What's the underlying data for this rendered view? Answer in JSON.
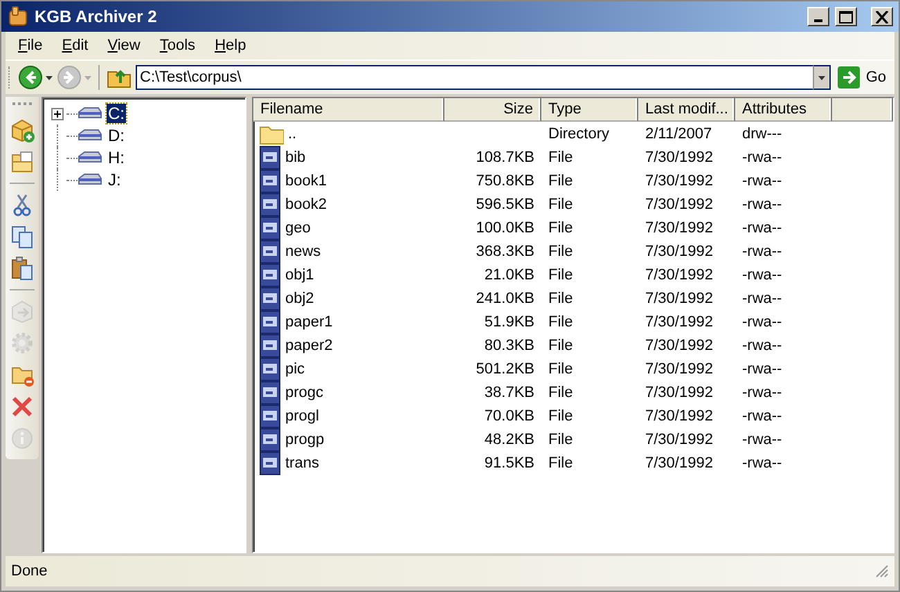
{
  "window": {
    "title": "KGB Archiver 2"
  },
  "menu": [
    "File",
    "Edit",
    "View",
    "Tools",
    "Help"
  ],
  "toolbar": {
    "back_disabled": false,
    "forward_disabled": true,
    "address": "C:\\Test\\corpus\\",
    "go_label": "Go"
  },
  "side_toolbar": [
    {
      "kind": "add",
      "disabled": false
    },
    {
      "kind": "open",
      "disabled": false
    },
    {
      "kind": "sep"
    },
    {
      "kind": "cut",
      "disabled": false
    },
    {
      "kind": "copy",
      "disabled": false
    },
    {
      "kind": "paste",
      "disabled": false
    },
    {
      "kind": "sep"
    },
    {
      "kind": "extract",
      "disabled": true
    },
    {
      "kind": "settings",
      "disabled": true
    },
    {
      "kind": "remove",
      "disabled": false
    },
    {
      "kind": "delete",
      "disabled": false
    },
    {
      "kind": "info",
      "disabled": true
    }
  ],
  "tree": [
    {
      "label": "C:",
      "selected": true,
      "kind": "collapsed"
    },
    {
      "label": "D:",
      "selected": false,
      "kind": "leaf"
    },
    {
      "label": "H:",
      "selected": false,
      "kind": "leaf"
    },
    {
      "label": "J:",
      "selected": false,
      "kind": "leaf"
    }
  ],
  "columns": [
    "Filename",
    "Size",
    "Type",
    "Last modif...",
    "Attributes"
  ],
  "rows": [
    {
      "kind": "folder",
      "name": "..",
      "size": "",
      "type": "Directory",
      "modified": "2/11/2007",
      "attributes": "drw---"
    },
    {
      "kind": "file",
      "name": "bib",
      "size": "108.7KB",
      "type": "File",
      "modified": "7/30/1992",
      "attributes": "-rwa--"
    },
    {
      "kind": "file",
      "name": "book1",
      "size": "750.8KB",
      "type": "File",
      "modified": "7/30/1992",
      "attributes": "-rwa--"
    },
    {
      "kind": "file",
      "name": "book2",
      "size": "596.5KB",
      "type": "File",
      "modified": "7/30/1992",
      "attributes": "-rwa--"
    },
    {
      "kind": "file",
      "name": "geo",
      "size": "100.0KB",
      "type": "File",
      "modified": "7/30/1992",
      "attributes": "-rwa--"
    },
    {
      "kind": "file",
      "name": "news",
      "size": "368.3KB",
      "type": "File",
      "modified": "7/30/1992",
      "attributes": "-rwa--"
    },
    {
      "kind": "file",
      "name": "obj1",
      "size": "21.0KB",
      "type": "File",
      "modified": "7/30/1992",
      "attributes": "-rwa--"
    },
    {
      "kind": "file",
      "name": "obj2",
      "size": "241.0KB",
      "type": "File",
      "modified": "7/30/1992",
      "attributes": "-rwa--"
    },
    {
      "kind": "file",
      "name": "paper1",
      "size": "51.9KB",
      "type": "File",
      "modified": "7/30/1992",
      "attributes": "-rwa--"
    },
    {
      "kind": "file",
      "name": "paper2",
      "size": "80.3KB",
      "type": "File",
      "modified": "7/30/1992",
      "attributes": "-rwa--"
    },
    {
      "kind": "file",
      "name": "pic",
      "size": "501.2KB",
      "type": "File",
      "modified": "7/30/1992",
      "attributes": "-rwa--"
    },
    {
      "kind": "file",
      "name": "progc",
      "size": "38.7KB",
      "type": "File",
      "modified": "7/30/1992",
      "attributes": "-rwa--"
    },
    {
      "kind": "file",
      "name": "progl",
      "size": "70.0KB",
      "type": "File",
      "modified": "7/30/1992",
      "attributes": "-rwa--"
    },
    {
      "kind": "file",
      "name": "progp",
      "size": "48.2KB",
      "type": "File",
      "modified": "7/30/1992",
      "attributes": "-rwa--"
    },
    {
      "kind": "file",
      "name": "trans",
      "size": "91.5KB",
      "type": "File",
      "modified": "7/30/1992",
      "attributes": "-rwa--"
    }
  ],
  "status_bar": "Done"
}
